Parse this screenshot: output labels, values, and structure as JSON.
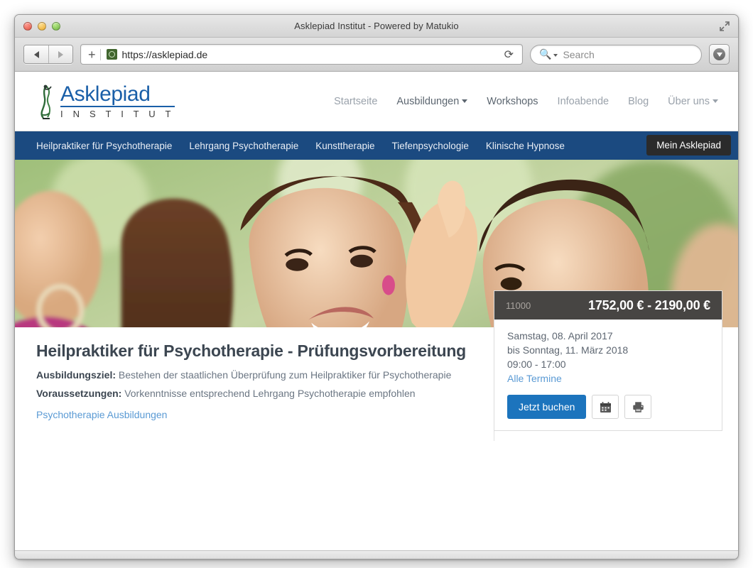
{
  "window": {
    "title": "Asklepiad Institut - Powered by Matukio",
    "traffic_lights": [
      "close",
      "minimize",
      "zoom"
    ],
    "fullscreen_icon": "fullscreen-expand-icon"
  },
  "toolbar": {
    "back_icon": "back-arrow-icon",
    "forward_icon": "forward-arrow-icon",
    "new_tab_icon": "plus-icon",
    "ssl_icon": "secure-site-icon",
    "url": "https://asklepiad.de",
    "reload_icon": "reload-icon",
    "search_placeholder": "Search",
    "search_icon": "search-magnifier-icon",
    "downloads_icon": "downloads-icon"
  },
  "site": {
    "logo": {
      "name": "Asklepiad",
      "subtitle": "I N S T I T U T",
      "mark": "asklepius-staff-icon",
      "color": "#1a5fa8"
    },
    "main_nav": [
      {
        "label": "Startseite",
        "has_caret": false,
        "active": false
      },
      {
        "label": "Ausbildungen",
        "has_caret": true,
        "active": true
      },
      {
        "label": "Workshops",
        "has_caret": false,
        "active": true
      },
      {
        "label": "Infoabende",
        "has_caret": false,
        "active": false
      },
      {
        "label": "Blog",
        "has_caret": false,
        "active": false
      },
      {
        "label": "Über uns",
        "has_caret": true,
        "active": false
      }
    ],
    "subnav": {
      "background": "#1b4a80",
      "items": [
        "Heilpraktiker für Psychotherapie",
        "Lehrgang Psychotherapie",
        "Kunsttherapie",
        "Tiefenpsychologie",
        "Klinische Hypnose"
      ],
      "account_button": "Mein Asklepiad"
    }
  },
  "course": {
    "title": "Heilpraktiker für Psychotherapie - Prüfungsvorbereitung",
    "goal_label": "Ausbildungsziel:",
    "goal_text": "Bestehen der staatlichen Überprüfung zum Heilpraktiker für Psychotherapie",
    "requirements_label": "Voraussetzungen:",
    "requirements_text": "Vorkenntnisse entsprechend Lehrgang Psychotherapie empfohlen",
    "category_link": "Psychotherapie Ausbildungen"
  },
  "panel": {
    "code": "11000",
    "price": "1752,00 € - 2190,00 €",
    "date_start": "Samstag, 08. April 2017",
    "date_end": "bis Sonntag, 11. März 2018",
    "time": "09:00 - 17:00",
    "all_dates_link": "Alle Termine",
    "book_button": "Jetzt buchen",
    "calendar_icon": "calendar-icon",
    "print_icon": "printer-icon",
    "accent_color": "#1c74bd"
  }
}
